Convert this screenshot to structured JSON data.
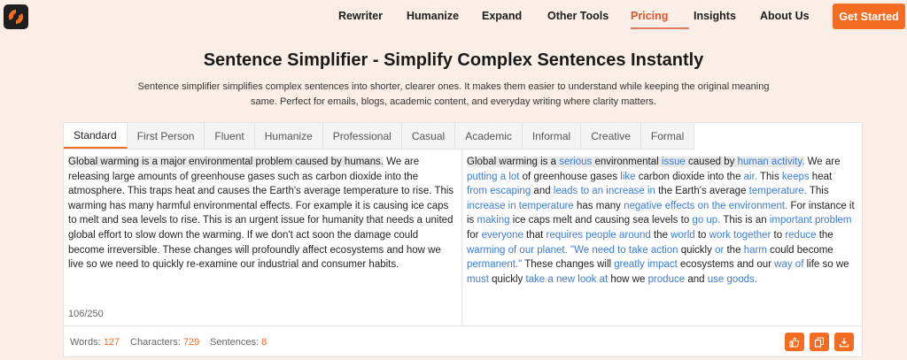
{
  "nav": {
    "items": [
      "Rewriter",
      "Humanize",
      "Expand",
      "Other Tools",
      "Pricing",
      "Insights",
      "About Us"
    ],
    "active": "Pricing",
    "cta": "Get Started"
  },
  "hero": {
    "title": "Sentence Simplifier - Simplify Complex Sentences Instantly",
    "subtitle": "Sentence simplifier simplifies complex sentences into shorter, clearer ones. It makes them easier to understand while keeping the original meaning same. Perfect for emails, blogs, academic content, and everyday writing where clarity matters."
  },
  "tabs": [
    "Standard",
    "First Person",
    "Fluent",
    "Humanize",
    "Professional",
    "Casual",
    "Academic",
    "Informal",
    "Creative",
    "Formal"
  ],
  "active_tab": "Standard",
  "input": {
    "highlighted": "Global warming is a major environmental problem caused by humans.",
    "rest": " We are releasing large amounts of greenhouse gases such as carbon dioxide into the atmosphere. This traps heat and causes the Earth's average temperature to rise. This warming has many harmful environmental effects. For example it is causing ice caps to melt and sea levels to rise. This is an urgent issue for humanity that needs a united global effort to slow down the warming. If we don't act soon the damage could become irreversible. These changes will profoundly affect ecosystems and how we live so we need to quickly re-examine our industrial and consumer habits.",
    "counter": "106/250"
  },
  "output": {
    "segments": [
      {
        "t": "Global warming is a ",
        "c": false
      },
      {
        "t": "serious",
        "c": true
      },
      {
        "t": " environmental ",
        "c": false
      },
      {
        "t": "issue",
        "c": true
      },
      {
        "t": " caused by ",
        "c": false
      },
      {
        "t": "human activity.",
        "c": true
      },
      {
        "t": " We are ",
        "c": false
      },
      {
        "t": "putting a lot",
        "c": true
      },
      {
        "t": " of greenhouse gases ",
        "c": false
      },
      {
        "t": "like",
        "c": true
      },
      {
        "t": " carbon dioxide into the ",
        "c": false
      },
      {
        "t": "air.",
        "c": true
      },
      {
        "t": " This ",
        "c": false
      },
      {
        "t": "keeps",
        "c": true
      },
      {
        "t": " heat ",
        "c": false
      },
      {
        "t": "from escaping",
        "c": true
      },
      {
        "t": " and ",
        "c": false
      },
      {
        "t": "leads",
        "c": true
      },
      {
        "t": " ",
        "c": false
      },
      {
        "t": "to an increase in",
        "c": true
      },
      {
        "t": " the Earth's average ",
        "c": false
      },
      {
        "t": "temperature.",
        "c": true
      },
      {
        "t": " This ",
        "c": false
      },
      {
        "t": "increase in temperature",
        "c": true
      },
      {
        "t": " has many ",
        "c": false
      },
      {
        "t": "negative effects on the environment.",
        "c": true
      },
      {
        "t": " For instance it is ",
        "c": false
      },
      {
        "t": "making",
        "c": true
      },
      {
        "t": " ice caps melt and causing sea levels to ",
        "c": false
      },
      {
        "t": "go up.",
        "c": true
      },
      {
        "t": " This is an ",
        "c": false
      },
      {
        "t": "important problem",
        "c": true
      },
      {
        "t": " for ",
        "c": false
      },
      {
        "t": "everyone",
        "c": true
      },
      {
        "t": " that ",
        "c": false
      },
      {
        "t": "requires people around",
        "c": true
      },
      {
        "t": " the ",
        "c": false
      },
      {
        "t": "world",
        "c": true
      },
      {
        "t": " to ",
        "c": false
      },
      {
        "t": "work together",
        "c": true
      },
      {
        "t": " to ",
        "c": false
      },
      {
        "t": "reduce",
        "c": true
      },
      {
        "t": " the ",
        "c": false
      },
      {
        "t": "warming of our planet.",
        "c": true
      },
      {
        "t": " ",
        "c": false
      },
      {
        "t": "\"We need to take action",
        "c": true
      },
      {
        "t": " quickly ",
        "c": false
      },
      {
        "t": "or",
        "c": true
      },
      {
        "t": " the ",
        "c": false
      },
      {
        "t": "harm",
        "c": true
      },
      {
        "t": " could become ",
        "c": false
      },
      {
        "t": "permanent.\"",
        "c": true
      },
      {
        "t": " These changes will ",
        "c": false
      },
      {
        "t": "greatly impact",
        "c": true
      },
      {
        "t": " ecosystems and our ",
        "c": false
      },
      {
        "t": "way of",
        "c": true
      },
      {
        "t": " life so we ",
        "c": false
      },
      {
        "t": "must",
        "c": true
      },
      {
        "t": " quickly ",
        "c": false
      },
      {
        "t": "take a new look at",
        "c": true
      },
      {
        "t": " how we ",
        "c": false
      },
      {
        "t": "produce",
        "c": true
      },
      {
        "t": " and ",
        "c": false
      },
      {
        "t": "use goods.",
        "c": true
      }
    ]
  },
  "stats": {
    "words_label": "Words:",
    "words": "127",
    "chars_label": "Characters:",
    "chars": "729",
    "sentences_label": "Sentences:",
    "sentences": "8"
  },
  "actions": [
    "thumbs-up-icon",
    "copy-icon",
    "download-icon"
  ],
  "colors": {
    "accent": "#f36c21",
    "rewrite": "#3c7bd6",
    "background": "#fbeee6"
  }
}
